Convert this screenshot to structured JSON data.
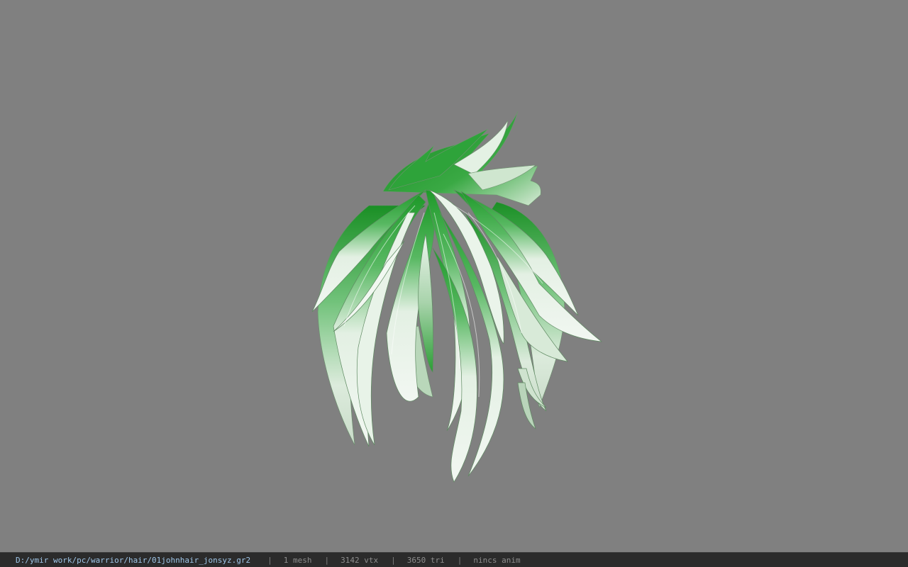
{
  "viewer": {
    "background_color": "#808080",
    "model": {
      "description": "green-tipped spiky hair mesh",
      "colors": {
        "root_green": "#1f9a2a",
        "mid_green": "#4fb55a",
        "strand_white": "#e6f1e6",
        "edge_shade": "#7a9c7c"
      }
    }
  },
  "status_bar": {
    "file_path": "D:/ymir work/pc/warrior/hair/01johnhair_jonsyz.gr2",
    "separator": "|",
    "mesh_count": "1 mesh",
    "vertex_count": "3142 vtx",
    "triangle_count": "3650 tri",
    "animation": "nincs anim"
  }
}
